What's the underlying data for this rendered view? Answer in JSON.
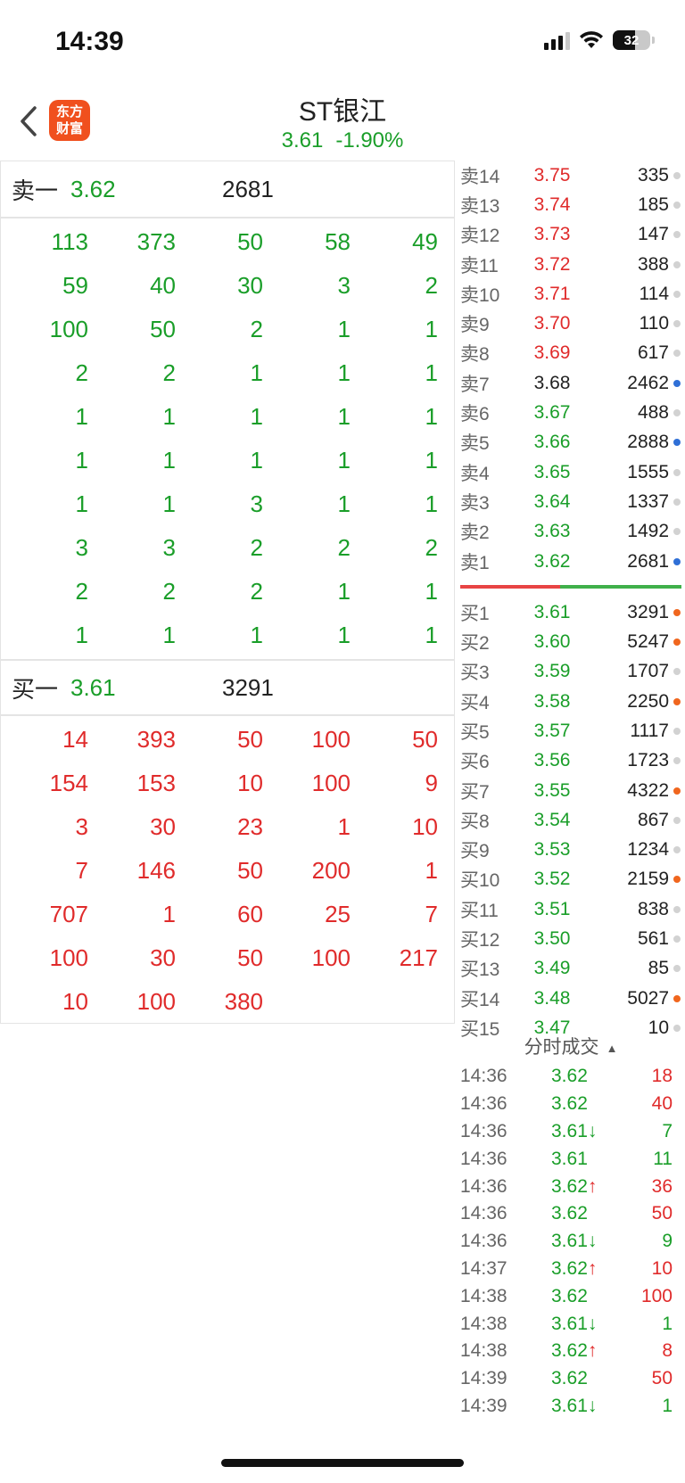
{
  "status_bar": {
    "time": "14:39",
    "battery": "32"
  },
  "header": {
    "logo_line1": "东方",
    "logo_line2": "财富",
    "stock_name": "ST银江",
    "price": "3.61",
    "change_pct": "-1.90%"
  },
  "sell_best": {
    "label": "卖一",
    "price": "3.62",
    "volume": "2681"
  },
  "sell_queue": [
    [
      "113",
      "373",
      "50",
      "58",
      "49"
    ],
    [
      "59",
      "40",
      "30",
      "3",
      "2"
    ],
    [
      "100",
      "50",
      "2",
      "1",
      "1"
    ],
    [
      "2",
      "2",
      "1",
      "1",
      "1"
    ],
    [
      "1",
      "1",
      "1",
      "1",
      "1"
    ],
    [
      "1",
      "1",
      "1",
      "1",
      "1"
    ],
    [
      "1",
      "1",
      "3",
      "1",
      "1"
    ],
    [
      "3",
      "3",
      "2",
      "2",
      "2"
    ],
    [
      "2",
      "2",
      "2",
      "1",
      "1"
    ],
    [
      "1",
      "1",
      "1",
      "1",
      "1"
    ]
  ],
  "buy_best": {
    "label": "买一",
    "price": "3.61",
    "volume": "3291"
  },
  "buy_queue": [
    [
      "14",
      "393",
      "50",
      "100",
      "50"
    ],
    [
      "154",
      "153",
      "10",
      "100",
      "9"
    ],
    [
      "3",
      "30",
      "23",
      "1",
      "10"
    ],
    [
      "7",
      "146",
      "50",
      "200",
      "1"
    ],
    [
      "707",
      "1",
      "60",
      "25",
      "7"
    ],
    [
      "100",
      "30",
      "50",
      "100",
      "217"
    ],
    [
      "10",
      "100",
      "380",
      "",
      ""
    ]
  ],
  "order_book_sell": [
    {
      "level": "卖14",
      "price": "3.75",
      "vol": "335",
      "color": "red",
      "dot": "gray"
    },
    {
      "level": "卖13",
      "price": "3.74",
      "vol": "185",
      "color": "red",
      "dot": "gray"
    },
    {
      "level": "卖12",
      "price": "3.73",
      "vol": "147",
      "color": "red",
      "dot": "gray"
    },
    {
      "level": "卖11",
      "price": "3.72",
      "vol": "388",
      "color": "red",
      "dot": "gray"
    },
    {
      "level": "卖10",
      "price": "3.71",
      "vol": "114",
      "color": "red",
      "dot": "gray"
    },
    {
      "level": "卖9",
      "price": "3.70",
      "vol": "110",
      "color": "red",
      "dot": "gray"
    },
    {
      "level": "卖8",
      "price": "3.69",
      "vol": "617",
      "color": "red",
      "dot": "gray"
    },
    {
      "level": "卖7",
      "price": "3.68",
      "vol": "2462",
      "color": "dark",
      "dot": "blue"
    },
    {
      "level": "卖6",
      "price": "3.67",
      "vol": "488",
      "color": "green",
      "dot": "gray"
    },
    {
      "level": "卖5",
      "price": "3.66",
      "vol": "2888",
      "color": "green",
      "dot": "blue"
    },
    {
      "level": "卖4",
      "price": "3.65",
      "vol": "1555",
      "color": "green",
      "dot": "gray"
    },
    {
      "level": "卖3",
      "price": "3.64",
      "vol": "1337",
      "color": "green",
      "dot": "gray"
    },
    {
      "level": "卖2",
      "price": "3.63",
      "vol": "1492",
      "color": "green",
      "dot": "gray"
    },
    {
      "level": "卖1",
      "price": "3.62",
      "vol": "2681",
      "color": "green",
      "dot": "blue"
    }
  ],
  "order_book_buy": [
    {
      "level": "买1",
      "price": "3.61",
      "vol": "3291",
      "color": "green",
      "dot": "orange"
    },
    {
      "level": "买2",
      "price": "3.60",
      "vol": "5247",
      "color": "green",
      "dot": "orange"
    },
    {
      "level": "买3",
      "price": "3.59",
      "vol": "1707",
      "color": "green",
      "dot": "gray"
    },
    {
      "level": "买4",
      "price": "3.58",
      "vol": "2250",
      "color": "green",
      "dot": "orange"
    },
    {
      "level": "买5",
      "price": "3.57",
      "vol": "1117",
      "color": "green",
      "dot": "gray"
    },
    {
      "level": "买6",
      "price": "3.56",
      "vol": "1723",
      "color": "green",
      "dot": "gray"
    },
    {
      "level": "买7",
      "price": "3.55",
      "vol": "4322",
      "color": "green",
      "dot": "orange"
    },
    {
      "level": "买8",
      "price": "3.54",
      "vol": "867",
      "color": "green",
      "dot": "gray"
    },
    {
      "level": "买9",
      "price": "3.53",
      "vol": "1234",
      "color": "green",
      "dot": "gray"
    },
    {
      "level": "买10",
      "price": "3.52",
      "vol": "2159",
      "color": "green",
      "dot": "orange"
    },
    {
      "level": "买11",
      "price": "3.51",
      "vol": "838",
      "color": "green",
      "dot": "gray"
    },
    {
      "level": "买12",
      "price": "3.50",
      "vol": "561",
      "color": "green",
      "dot": "gray"
    },
    {
      "level": "买13",
      "price": "3.49",
      "vol": "85",
      "color": "green",
      "dot": "gray"
    },
    {
      "level": "买14",
      "price": "3.48",
      "vol": "5027",
      "color": "green",
      "dot": "orange"
    },
    {
      "level": "买15",
      "price": "3.47",
      "vol": "10",
      "color": "green",
      "dot": "gray"
    }
  ],
  "ticks_title": "分时成交",
  "ticks": [
    {
      "time": "14:36",
      "price": "3.62",
      "arrow": "",
      "vol": "18",
      "vol_color": "red"
    },
    {
      "time": "14:36",
      "price": "3.62",
      "arrow": "",
      "vol": "40",
      "vol_color": "red"
    },
    {
      "time": "14:36",
      "price": "3.61",
      "arrow": "↓",
      "vol": "7",
      "vol_color": "green"
    },
    {
      "time": "14:36",
      "price": "3.61",
      "arrow": "",
      "vol": "11",
      "vol_color": "green"
    },
    {
      "time": "14:36",
      "price": "3.62",
      "arrow": "↑",
      "vol": "36",
      "vol_color": "red"
    },
    {
      "time": "14:36",
      "price": "3.62",
      "arrow": "",
      "vol": "50",
      "vol_color": "red"
    },
    {
      "time": "14:36",
      "price": "3.61",
      "arrow": "↓",
      "vol": "9",
      "vol_color": "green"
    },
    {
      "time": "14:37",
      "price": "3.62",
      "arrow": "↑",
      "vol": "10",
      "vol_color": "red"
    },
    {
      "time": "14:38",
      "price": "3.62",
      "arrow": "",
      "vol": "100",
      "vol_color": "red"
    },
    {
      "time": "14:38",
      "price": "3.61",
      "arrow": "↓",
      "vol": "1",
      "vol_color": "green"
    },
    {
      "time": "14:38",
      "price": "3.62",
      "arrow": "↑",
      "vol": "8",
      "vol_color": "red"
    },
    {
      "time": "14:39",
      "price": "3.62",
      "arrow": "",
      "vol": "50",
      "vol_color": "red"
    },
    {
      "time": "14:39",
      "price": "3.61",
      "arrow": "↓",
      "vol": "1",
      "vol_color": "green"
    }
  ]
}
